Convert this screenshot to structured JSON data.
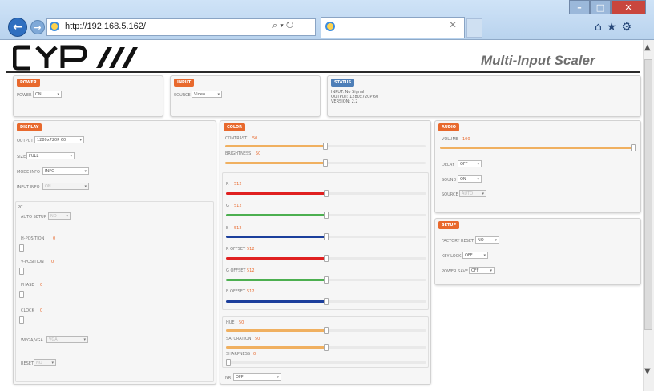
{
  "browser": {
    "url": "http://192.168.5.162/",
    "search_glyph": "⌕ ▾ ↻",
    "home_icon": "home-icon",
    "star_icon": "star-icon",
    "gear_icon": "gear-icon"
  },
  "header": {
    "app_name": "Multi-Input Scaler",
    "logo": "CYP"
  },
  "colors": {
    "accent": "#e8692d",
    "blue_tag": "#4e7fb8",
    "red": "#e02020",
    "green": "#4caf50",
    "blue": "#1c3f9c",
    "orange": "#f0b060"
  },
  "power": {
    "tag": "POWER",
    "label": "POWER",
    "value": "ON"
  },
  "input": {
    "tag": "INPUT",
    "label": "SOURCE",
    "value": "Video"
  },
  "status": {
    "tag": "STATUS",
    "input": "INPUT: No Signal",
    "output": "OUTPUT: 1280x720P 60",
    "version": "VERSION: 2.2"
  },
  "display": {
    "tag": "DISPLAY",
    "output_label": "OUTPUT",
    "output_value": "1280x720P 60",
    "size_label": "SIZE",
    "size_value": "FULL",
    "mode_label": "MODE INFO",
    "mode_value": "INFO",
    "input_label": "INPUT INFO",
    "input_value": "ON",
    "pc_title": "PC",
    "auto_label": "AUTO SETUP",
    "auto_value": "NO",
    "hpos_label": "H-POSITION",
    "hpos_value": "0",
    "vpos_label": "V-POSITION",
    "vpos_value": "0",
    "phase_label": "PHASE",
    "phase_value": "0",
    "clock_label": "CLOCK",
    "clock_value": "0",
    "wega_label": "WEGA/VGA",
    "wega_value": "VGA",
    "reset_label": "RESET",
    "reset_value": "NO"
  },
  "color": {
    "tag": "COLOR",
    "contrast_label": "CONTRAST",
    "contrast_value": "50",
    "contrast_level": 0.5,
    "brightness_label": "BRIGHTNESS",
    "brightness_value": "50",
    "brightness_level": 0.5,
    "r_label": "R",
    "r_value": "512",
    "r_level": 0.5,
    "g_label": "G",
    "g_value": "512",
    "g_level": 0.5,
    "b_label": "B",
    "b_value": "512",
    "b_level": 0.5,
    "roff_label": "R OFFSET",
    "roff_value": "512",
    "roff_level": 0.5,
    "goff_label": "G OFFSET",
    "goff_value": "512",
    "goff_level": 0.5,
    "boff_label": "B OFFSET",
    "boff_value": "512",
    "boff_level": 0.5,
    "hue_label": "HUE",
    "hue_value": "50",
    "hue_level": 0.5,
    "sat_label": "SATURATION",
    "sat_value": "50",
    "sat_level": 0.5,
    "sharp_label": "SHARPNESS",
    "sharp_value": "0",
    "sharp_level": 0.0,
    "nr_label": "NR",
    "nr_value": "OFF"
  },
  "audio": {
    "tag": "AUDIO",
    "volume_label": "VOLUME",
    "volume_value": "100",
    "volume_level": 1.0,
    "delay_label": "DELAY",
    "delay_value": "OFF",
    "sound_label": "SOUND",
    "sound_value": "ON",
    "source_label": "SOURCE",
    "source_value": "AUTO"
  },
  "setup": {
    "tag": "SETUP",
    "factory_label": "FACTORY RESET",
    "factory_value": "NO",
    "key_label": "KEY LOCK",
    "key_value": "OFF",
    "power_label": "POWER SAVE",
    "power_value": "OFF"
  }
}
